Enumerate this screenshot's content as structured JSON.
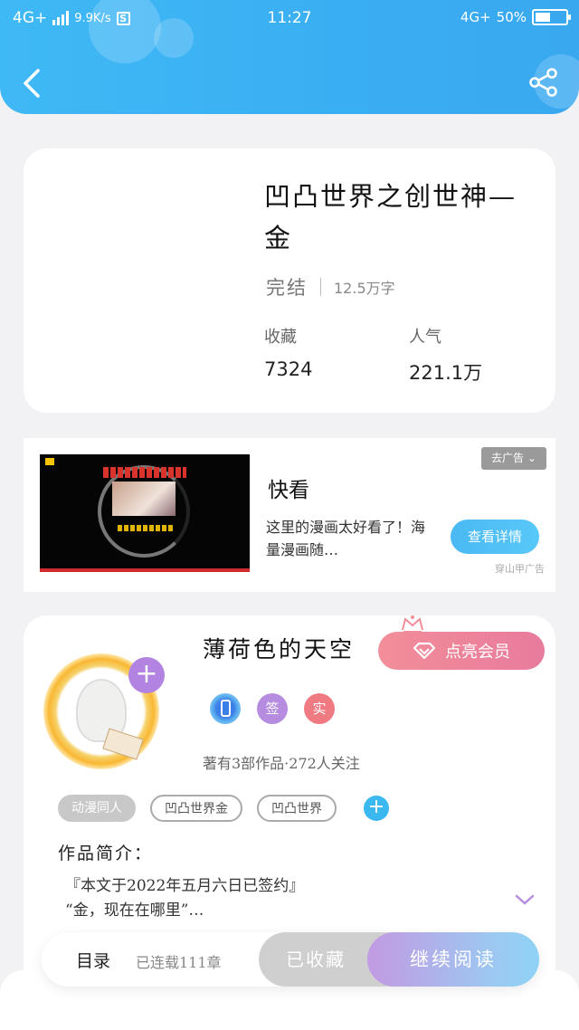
{
  "status_bar": {
    "network_left": "4G+",
    "speed": "9.9K/s",
    "s_icon": "S",
    "time": "11:27",
    "network_right": "4G+",
    "battery": "50%",
    "battery_level": 0.5
  },
  "header": {
    "back_icon": "chevron-left",
    "share_icon": "share"
  },
  "book": {
    "title": "凹凸世界之创世神—金",
    "status": "完结",
    "word_count": "12.5万字",
    "favorites_label": "收藏",
    "favorites_value": "7324",
    "popularity_label": "人气",
    "popularity_value": "221.1万"
  },
  "ad": {
    "brand": "快看",
    "description": "这里的漫画太好看了！海量漫画随…",
    "close_label": "去广告",
    "cta_label": "查看详情",
    "source": "穿山甲广告"
  },
  "author": {
    "name": "薄荷色的天空",
    "vip_label": "点亮会员",
    "badge_sign": "签",
    "badge_real": "实",
    "stats": "著有3部作品·272人关注",
    "tags": [
      "动漫同人",
      "凹凸世界金",
      "凹凸世界"
    ],
    "intro_title": "作品简介：",
    "intro_line1": "『本文于2022年五月六日已签约』",
    "intro_line2": "“金，现在在哪里”…"
  },
  "bottom_bar": {
    "toc_label": "目录",
    "serial_status": "已连载111章",
    "collected_label": "已收藏",
    "read_label": "继续阅读"
  },
  "colors": {
    "header": "#3fb9f5",
    "accent_purple": "#b283e0",
    "vip_pink": "#f28e99",
    "tag_add_blue": "#3cb8f0"
  }
}
